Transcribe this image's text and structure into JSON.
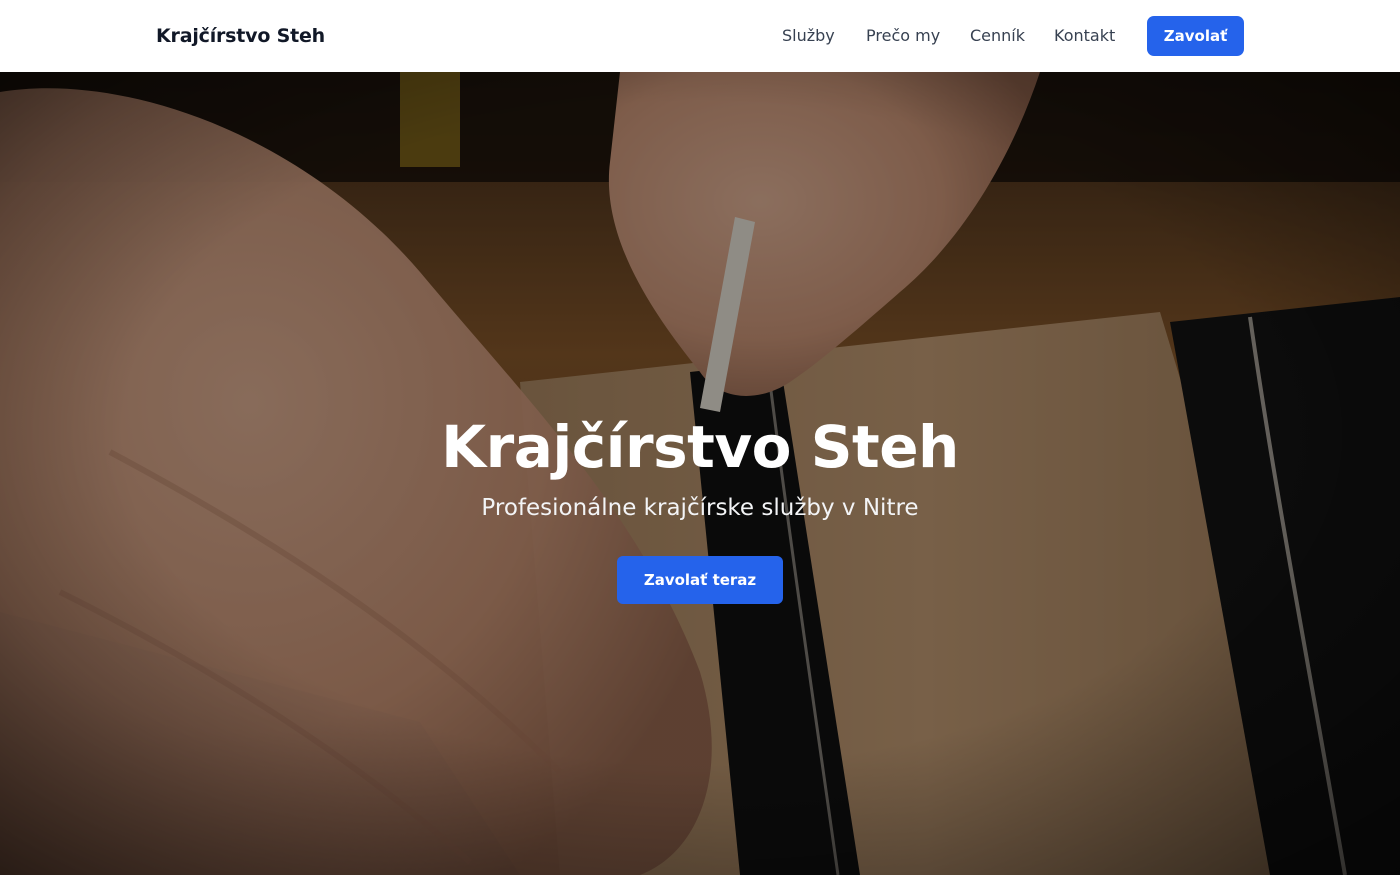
{
  "navbar": {
    "logo": "Krajčírstvo Steh",
    "links": [
      {
        "label": "Služby"
      },
      {
        "label": "Prečo my"
      },
      {
        "label": "Cenník"
      },
      {
        "label": "Kontakt"
      }
    ],
    "cta_label": "Zavolať"
  },
  "hero": {
    "title": "Krajčírstvo Steh",
    "subtitle": "Profesionálne krajčírske služby v Nitre",
    "cta_label": "Zavolať teraz",
    "image_alt": "tailor hands marking fabric with chalk"
  },
  "colors": {
    "accent": "#2563eb",
    "navbar_bg": "#ffffff",
    "logo_text": "#111827",
    "nav_text": "#374151"
  }
}
